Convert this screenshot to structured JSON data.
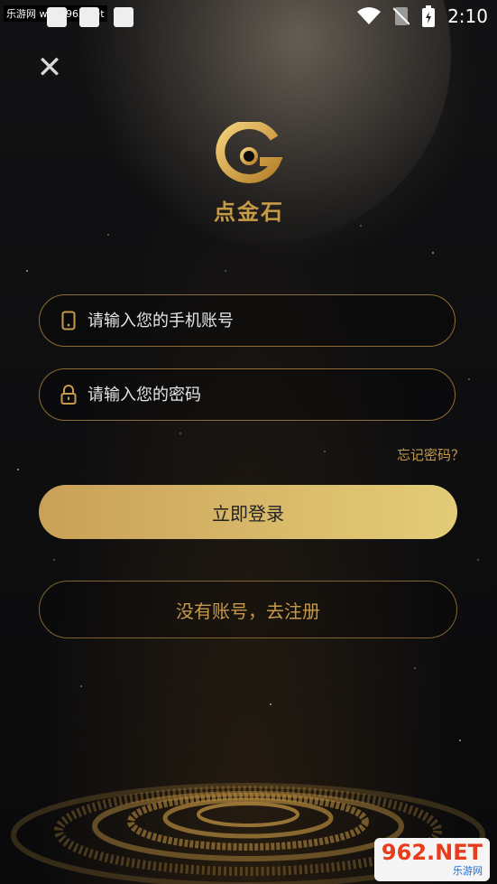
{
  "status_bar": {
    "watermark": "乐游网 www.962.net",
    "time": "2:10"
  },
  "login": {
    "brand_name": "点金石",
    "phone_placeholder": "请输入您的手机账号",
    "password_placeholder": "请输入您的密码",
    "forgot_label": "忘记密码？",
    "login_label": "立即登录",
    "register_label": "没有账号，去注册"
  },
  "site_badge": {
    "number": "962.NET",
    "sub": "乐游网"
  },
  "colors": {
    "accent_gold": "#c79a4a",
    "button_gradient_start": "#c9a057",
    "button_gradient_end": "#e3cc78",
    "background": "#0c0c0e"
  }
}
